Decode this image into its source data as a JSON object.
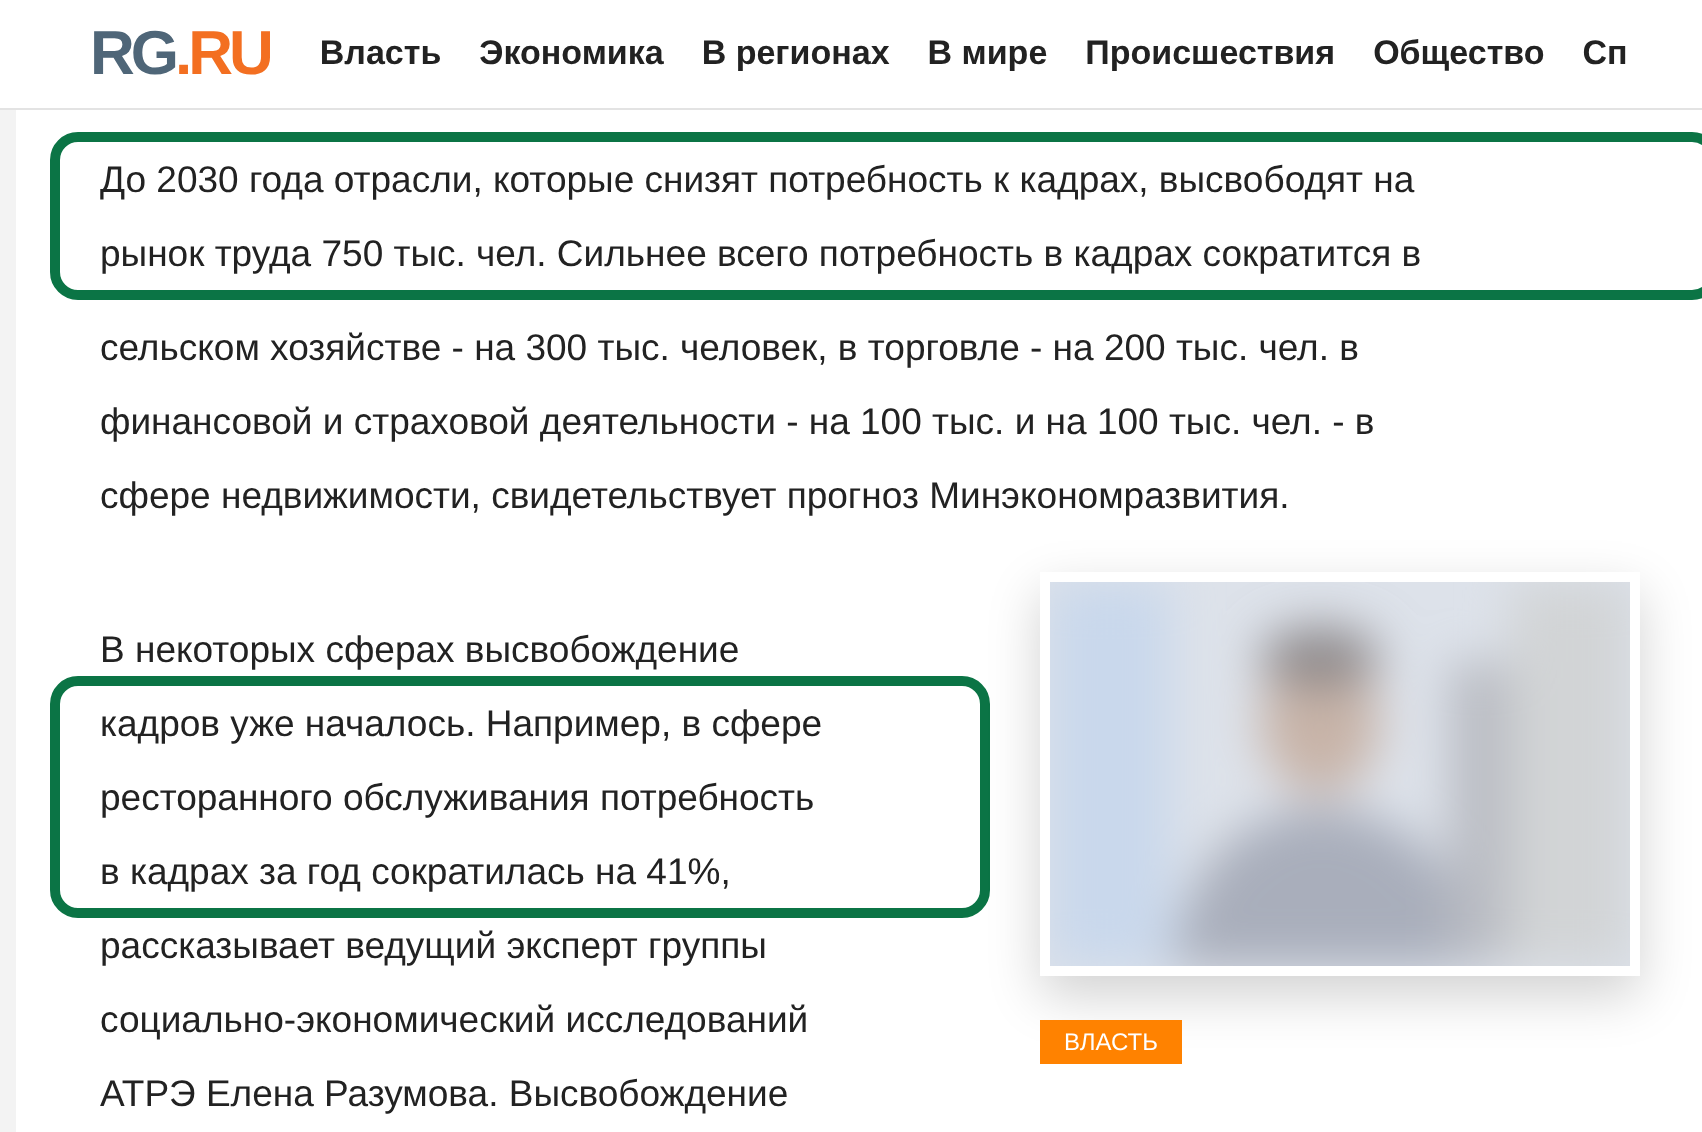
{
  "logo": {
    "part_1": "RG",
    "part_2": ".RU"
  },
  "nav": [
    "Власть",
    "Экономика",
    "В регионах",
    "В мире",
    "Происшествия",
    "Общество",
    "Сп"
  ],
  "paragraphs": [
    {
      "groups": [
        {
          "highlighted": true,
          "lines": [
            "До 2030 года отрасли, которые снизят потребность к кадрах, высвободят на",
            "рынок труда 750 тыс. чел. Сильнее всего потребность в кадрах сократится в"
          ]
        },
        {
          "highlighted": false,
          "lines": [
            "сельском хозяйстве - на 300 тыс. человек, в торговле - на 200 тыс. чел. в",
            "финансовой и страховой деятельности - на 100 тыс. и на 100 тыс. чел. - в",
            "сфере недвижимости, свидетельствует прогноз Минэкономразвития."
          ]
        }
      ]
    },
    {
      "groups": [
        {
          "highlighted": false,
          "lines": [
            "В некоторых сферах высвобождение"
          ]
        },
        {
          "highlighted": true,
          "lines": [
            "кадров уже началось. Например, в сфере",
            "ресторанного обслуживания потребность",
            "в кадрах за год сократилась на 41%,"
          ]
        },
        {
          "highlighted": false,
          "lines": [
            "рассказывает ведущий эксперт группы",
            "социально-экономический исследований",
            "АТРЭ Елена Разумова. Высвобождение"
          ]
        }
      ]
    }
  ],
  "side_card": {
    "kind": "picture",
    "tag": "ВЛАСТЬ"
  }
}
